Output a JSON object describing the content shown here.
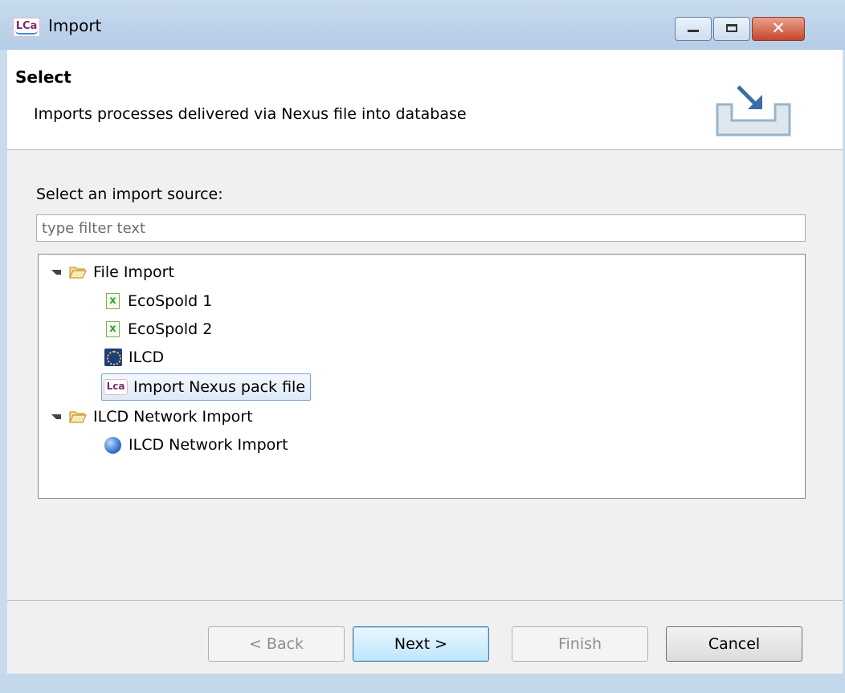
{
  "window": {
    "title": "Import",
    "app_icon_text": "LCa"
  },
  "header": {
    "title": "Select",
    "description": "Imports processes delivered via Nexus file into database"
  },
  "source": {
    "label": "Select an import source:",
    "filter_placeholder": "type filter text",
    "filter_value": ""
  },
  "tree": {
    "file_import": "File Import",
    "ecospold1": "EcoSpold 1",
    "ecospold2": "EcoSpold 2",
    "ilcd": "ILCD",
    "nexus": "Import Nexus pack file",
    "ilcd_network_group": "ILCD Network Import",
    "ilcd_network_item": "ILCD Network Import",
    "selected": "Import Nexus pack file",
    "icons": {
      "file_import": "folder-open-icon",
      "ecospold": "excel-file-icon",
      "ilcd": "ilcd-icon",
      "nexus": "lca-icon",
      "network": "globe-icon"
    }
  },
  "buttons": {
    "back": "< Back",
    "next": "Next >",
    "finish": "Finish",
    "cancel": "Cancel"
  },
  "colors": {
    "accent": "#3c7fb1",
    "titlebar": "#c7daee",
    "close": "#c8452b"
  }
}
